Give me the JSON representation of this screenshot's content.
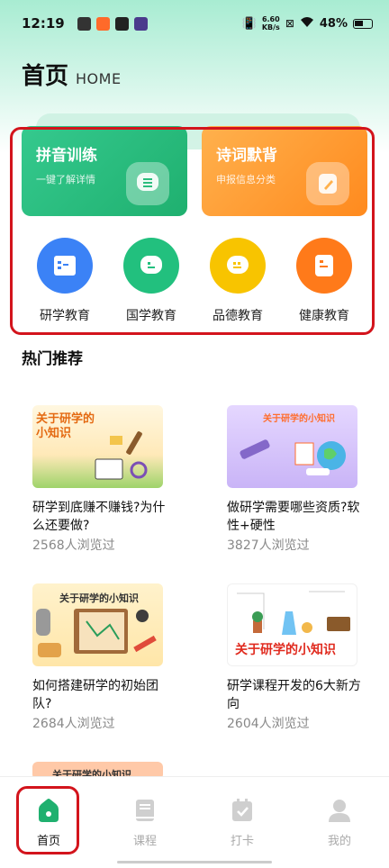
{
  "status_bar": {
    "time": "12:19",
    "net_speed_value": "6.60",
    "net_speed_unit": "KB/s",
    "battery": "48%"
  },
  "header": {
    "title": "首页",
    "subtitle": "HOME"
  },
  "feature_cards": [
    {
      "title": "拼音训练",
      "subtitle": "一键了解详情",
      "icon": "chat-bubble-icon",
      "color": "#2bbd7e"
    },
    {
      "title": "诗词默背",
      "subtitle": "申报信息分类",
      "icon": "edit-note-icon",
      "color": "#ff9a30"
    }
  ],
  "categories": [
    {
      "label": "研学教育",
      "icon": "book-icon",
      "color": "#3b82f6"
    },
    {
      "label": "国学教育",
      "icon": "chat-icon",
      "color": "#22c07e"
    },
    {
      "label": "品德教育",
      "icon": "message-icon",
      "color": "#f8c400"
    },
    {
      "label": "健康教育",
      "icon": "document-icon",
      "color": "#ff7a1a"
    }
  ],
  "section": {
    "title": "热门推荐"
  },
  "articles": [
    {
      "thumb_text": "关于研学的小知识",
      "title": "研学到底赚不赚钱?为什么还要做?",
      "views": "2568人浏览过"
    },
    {
      "thumb_text": "关于研学的小知识",
      "title": "做研学需要哪些资质?软性+硬性",
      "views": "3827人浏览过"
    },
    {
      "thumb_text": "关于研学的小知识",
      "title": "如何搭建研学的初始团队?",
      "views": "2684人浏览过"
    },
    {
      "thumb_text": "关于研学的小知识",
      "title": "研学课程开发的6大新方向",
      "views": "2604人浏览过"
    },
    {
      "thumb_text": "关于研学的小知识"
    }
  ],
  "tab_bar": [
    {
      "label": "首页",
      "icon": "home-icon",
      "active": true
    },
    {
      "label": "课程",
      "icon": "book-icon",
      "active": false
    },
    {
      "label": "打卡",
      "icon": "calendar-check-icon",
      "active": false
    },
    {
      "label": "我的",
      "icon": "user-icon",
      "active": false
    }
  ],
  "colors": {
    "highlight": "#d3141c",
    "accent_green": "#1fb06f"
  }
}
